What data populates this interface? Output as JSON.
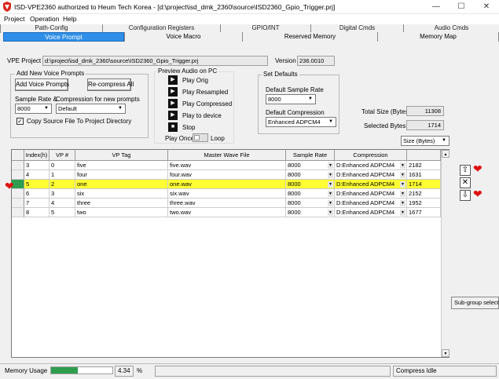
{
  "window": {
    "title": "ISD-VPE2360 authorized to Heum Tech Korea - [d:\\project\\isd_dmk_2360\\source\\ISD2360_Gpio_Trigger.prj]",
    "minimize_glyph": "—",
    "maximize_glyph": "☐",
    "close_glyph": "✕"
  },
  "menu": [
    "Project",
    "Operation",
    "Help"
  ],
  "tabs_back": [
    "Path-Config",
    "Configuration Registers",
    "GPIO/INT",
    "Digital Cmds",
    "Audio Cmds"
  ],
  "tabs_front": [
    "Voice Prompt",
    "Voice Macro",
    "Reserved Memory",
    "Memory Map"
  ],
  "active_tab": "Voice Prompt",
  "project": {
    "label": "VPE Project",
    "path": "d:\\project\\isd_dmk_2360\\source\\ISD2360_Gpio_Trigger.prj",
    "version_label": "Version",
    "version": "236.0010"
  },
  "add_group": {
    "title": "Add New Voice Prompts",
    "add_button": "Add Voice Prompts",
    "recompress_button": "Re-compress All",
    "sample_rate_label": "Sample Rate &",
    "sample_rate_value": "8000",
    "compression_label": "Compression for new prompts",
    "compression_value": "Default",
    "copy_label": "Copy Source File To Project Directory",
    "copy_checked": true
  },
  "preview": {
    "title": "Preview Audio on PC",
    "buttons": [
      "Play Orig",
      "Play Resampled",
      "Play Compressed",
      "Play to device",
      "Stop"
    ],
    "play_once_label": "Play Once",
    "loop_label": "Loop"
  },
  "defaults": {
    "title": "Set Defaults",
    "sample_rate_label": "Default Sample Rate",
    "sample_rate_value": "8000",
    "compression_label": "Default Compression",
    "compression_value": "Enhanced ADPCM4"
  },
  "sizes": {
    "total_label": "Total Size (Bytes)",
    "total_value": "11308",
    "selected_label": "Selected Bytes",
    "selected_value": "1714",
    "unit_value": "Size (Bytes)"
  },
  "grid": {
    "columns": [
      "Index(h)",
      "VP #",
      "VP Tag",
      "Master Wave File",
      "Sample Rate",
      "Compression"
    ],
    "rows": [
      {
        "index": "3",
        "vp": "0",
        "tag": "five",
        "file": "five.wav",
        "rate": "8000",
        "comp": "D:Enhanced ADPCM4",
        "size": "2182"
      },
      {
        "index": "4",
        "vp": "1",
        "tag": "four",
        "file": "four.wav",
        "rate": "8000",
        "comp": "D:Enhanced ADPCM4",
        "size": "1631"
      },
      {
        "index": "5",
        "vp": "2",
        "tag": "one",
        "file": "one.wav",
        "rate": "8000",
        "comp": "D:Enhanced ADPCM4",
        "size": "1714"
      },
      {
        "index": "6",
        "vp": "3",
        "tag": "six",
        "file": "six.wav",
        "rate": "8000",
        "comp": "D:Enhanced ADPCM4",
        "size": "2152"
      },
      {
        "index": "7",
        "vp": "4",
        "tag": "three",
        "file": "three.wav",
        "rate": "8000",
        "comp": "D:Enhanced ADPCM4",
        "size": "1952"
      },
      {
        "index": "8",
        "vp": "5",
        "tag": "two",
        "file": "two.wav",
        "rate": "8000",
        "comp": "D:Enhanced ADPCM4",
        "size": "1677"
      }
    ],
    "highlight_row": 2,
    "highlight_color": "#ffff33"
  },
  "side": {
    "subgroup_label": "Sub-group selecti"
  },
  "status": {
    "memory_label": "Memory Usage",
    "memory_value": "4.34",
    "memory_unit": "%",
    "memory_fraction": 0.0434,
    "compress_status": "Compress Idle"
  }
}
